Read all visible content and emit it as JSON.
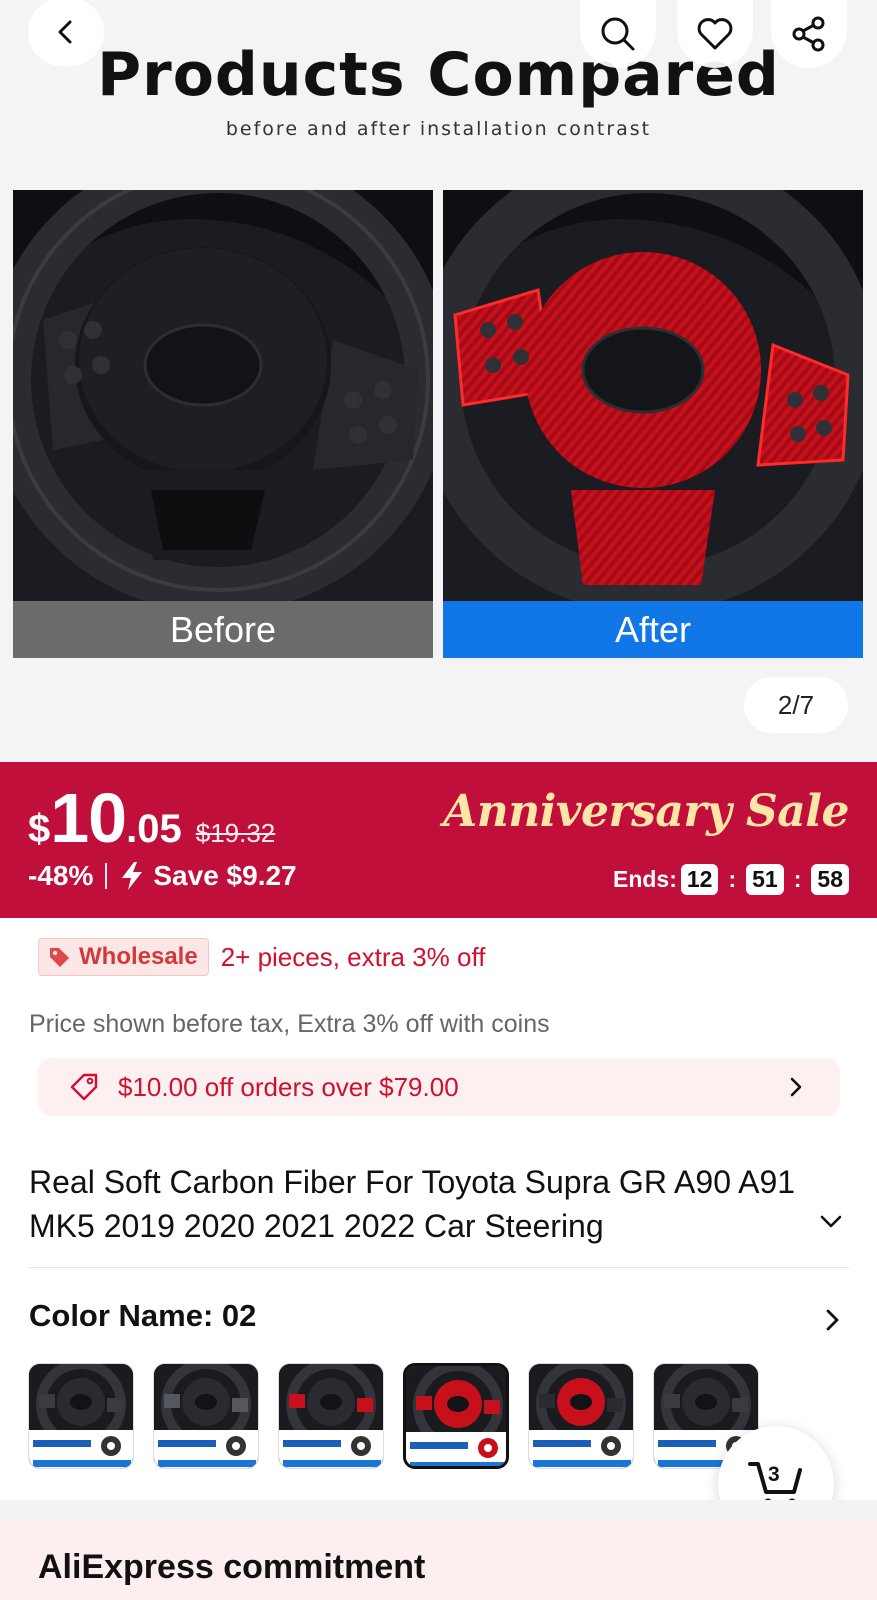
{
  "gallery": {
    "title": "Products Compared",
    "subtitle": "before and after installation contrast",
    "before_label": "Before",
    "after_label": "After",
    "counter": "2/7"
  },
  "header_icons": [
    "back-icon",
    "search-icon",
    "heart-icon",
    "share-icon"
  ],
  "price": {
    "currency": "$",
    "integer": "10",
    "decimal": ".05",
    "original": "$19.32",
    "discount": "-48%",
    "save": "Save $9.27",
    "sale_title": "Anniversary Sale",
    "ends_label": "Ends:",
    "hours": "12",
    "minutes": "51",
    "seconds": "58"
  },
  "wholesale": {
    "badge": "Wholesale",
    "text": "2+ pieces, extra 3% off"
  },
  "tax_note": "Price shown before tax, Extra 3% off with coins",
  "coupon": "$10.00 off orders over $79.00",
  "product_title": "Real Soft Carbon Fiber For Toyota Supra GR A90 A91 MK5 2019 2020 2021 2022 Car Steering",
  "color": {
    "label": "Color Name: 02",
    "selected_index": 3,
    "swatch_count": 6
  },
  "cart": {
    "count": "3"
  },
  "commitment_title": "AliExpress commitment",
  "colors": {
    "brand_red": "#c10f3c",
    "sale_gold": "#ffe6a6",
    "coupon_red": "#d0102e",
    "after_blue": "#1177e6"
  }
}
